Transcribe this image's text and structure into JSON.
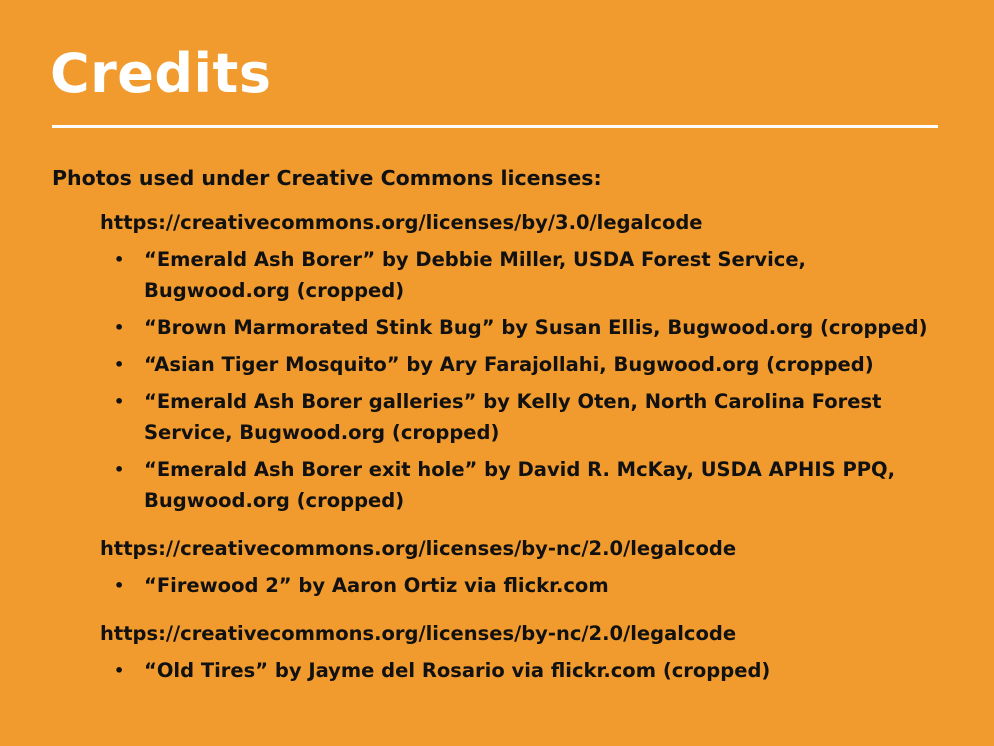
{
  "slide": {
    "title": "Credits",
    "intro": "Photos used under Creative Commons licenses:",
    "bullet_glyph": "•",
    "license_groups": [
      {
        "url": "https://creativecommons.org/licenses/by/3.0/legalcode",
        "items": [
          "“Emerald Ash Borer” by Debbie Miller, USDA Forest Service, Bugwood.org (cropped)",
          "“Brown Marmorated Stink Bug” by Susan Ellis, Bugwood.org (cropped)",
          "“Asian Tiger Mosquito” by Ary Farajollahi, Bugwood.org (cropped)",
          "“Emerald Ash Borer galleries” by Kelly Oten, North Carolina Forest Service, Bugwood.org (cropped)",
          "“Emerald Ash Borer exit hole” by David R. McKay, USDA APHIS PPQ, Bugwood.org (cropped)"
        ]
      },
      {
        "url": "https://creativecommons.org/licenses/by-nc/2.0/legalcode",
        "items": [
          "“Firewood 2” by Aaron Ortiz via flickr.com"
        ]
      },
      {
        "url": "https://creativecommons.org/licenses/by-nc/2.0/legalcode",
        "items": [
          "“Old Tires” by Jayme del Rosario via flickr.com (cropped)"
        ]
      }
    ]
  }
}
